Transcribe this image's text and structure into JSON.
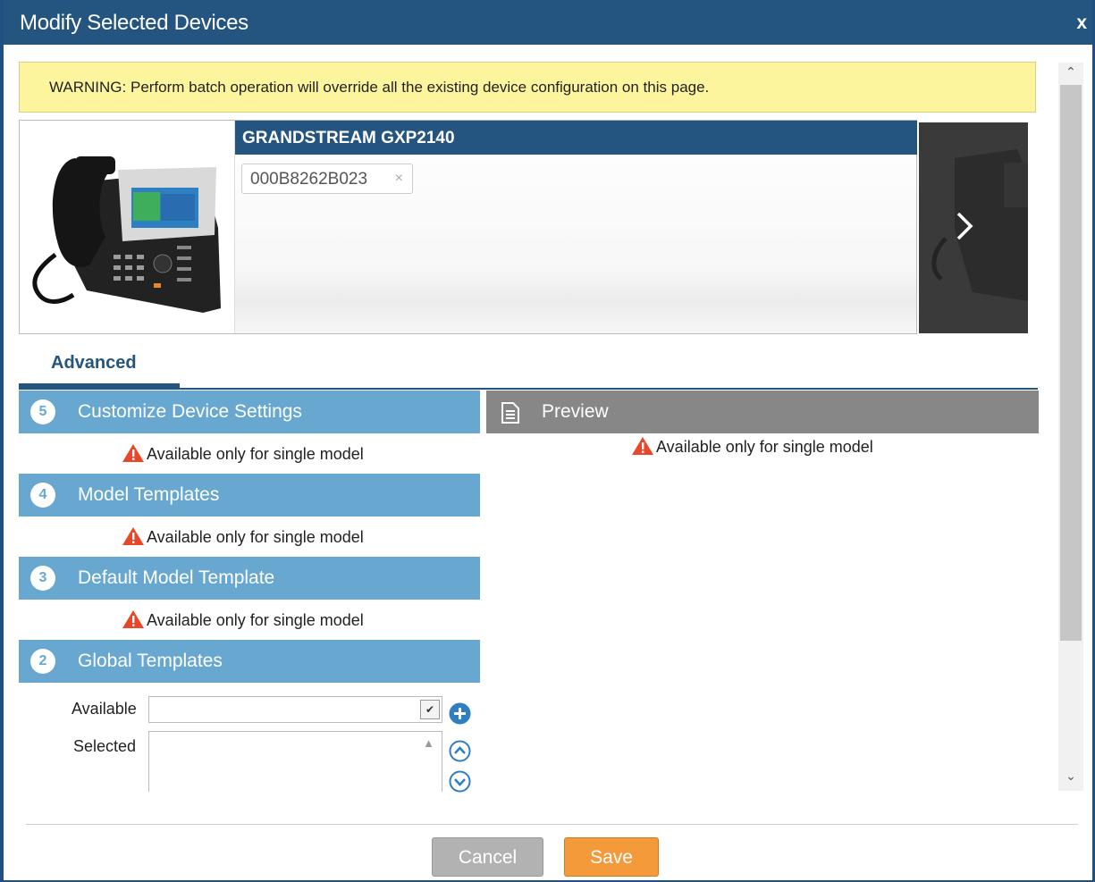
{
  "dialog": {
    "title": "Modify Selected Devices",
    "close_label": "x"
  },
  "warning": {
    "text": "WARNING: Perform batch operation will override all the existing device configuration on this page."
  },
  "device": {
    "model": "GRANDSTREAM GXP2140",
    "mac": "000B8262B023",
    "remove_label": "×"
  },
  "tabs": {
    "active": "Advanced"
  },
  "sections": [
    {
      "num": "5",
      "title": "Customize Device Settings",
      "notice": "Available only for single model"
    },
    {
      "num": "4",
      "title": "Model Templates",
      "notice": "Available only for single model"
    },
    {
      "num": "3",
      "title": "Default Model Template",
      "notice": "Available only for single model"
    },
    {
      "num": "2",
      "title": "Global Templates"
    }
  ],
  "preview": {
    "title": "Preview",
    "notice": "Available only for single model"
  },
  "global_templates": {
    "available_label": "Available",
    "selected_label": "Selected",
    "available_value": ""
  },
  "buttons": {
    "cancel": "Cancel",
    "save": "Save"
  },
  "colors": {
    "titlebar": "#245580",
    "section": "#68a8d0",
    "preview": "#878787",
    "warning_bg": "#fdf59d",
    "save": "#f49a3b",
    "cancel": "#b2b2b2",
    "alert": "#e8472c"
  },
  "icons": {
    "close": "close-icon",
    "next": "chevron-right-icon",
    "preview": "document-icon",
    "alert": "warning-triangle-icon",
    "add": "plus-circle-icon",
    "up": "chevron-up-circle-icon",
    "down": "chevron-down-circle-icon"
  }
}
